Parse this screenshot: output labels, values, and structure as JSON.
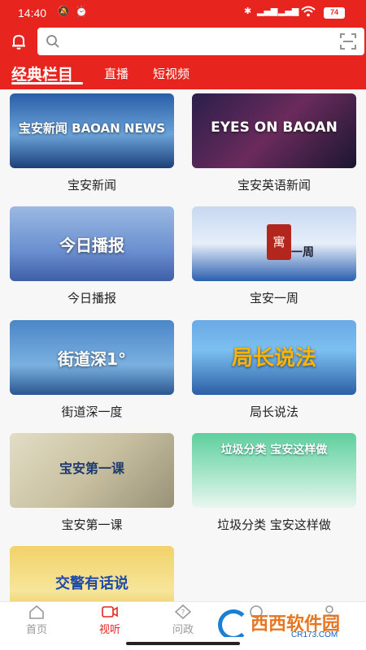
{
  "status_bar": {
    "time": "14:40",
    "battery": "74"
  },
  "search": {
    "placeholder": ""
  },
  "tabs": [
    {
      "label": "经典栏目",
      "active": true
    },
    {
      "label": "直播",
      "active": false
    },
    {
      "label": "短视频",
      "active": false
    }
  ],
  "programs": [
    {
      "label": "宝安新闻",
      "thumb_text": "宝安新闻 BAOAN NEWS"
    },
    {
      "label": "宝安英语新闻",
      "thumb_text": "EYES ON BAOAN"
    },
    {
      "label": "今日播报",
      "thumb_text": "今日播报"
    },
    {
      "label": "宝安一周",
      "thumb_text": "一周"
    },
    {
      "label": "街道深一度",
      "thumb_text": "街道深1°"
    },
    {
      "label": "局长说法",
      "thumb_text": "局长说法"
    },
    {
      "label": "宝安第一课",
      "thumb_text": "宝安第一课"
    },
    {
      "label": "垃圾分类 宝安这样做",
      "thumb_text": "垃圾分类 宝安这样做"
    },
    {
      "label": "",
      "thumb_text": "交警有话说"
    }
  ],
  "bottom_nav": [
    {
      "label": "首页",
      "icon": "home-icon",
      "active": false
    },
    {
      "label": "视听",
      "icon": "video-icon",
      "active": true
    },
    {
      "label": "问政",
      "icon": "question-icon",
      "active": false
    },
    {
      "label": "",
      "icon": "service-icon",
      "active": false
    },
    {
      "label": "",
      "icon": "profile-icon",
      "active": false
    }
  ],
  "watermark": {
    "text": "西西软件园",
    "sub": "CR173.COM"
  },
  "colors": {
    "brand_red": "#e8241f",
    "inactive_gray": "#999999"
  }
}
